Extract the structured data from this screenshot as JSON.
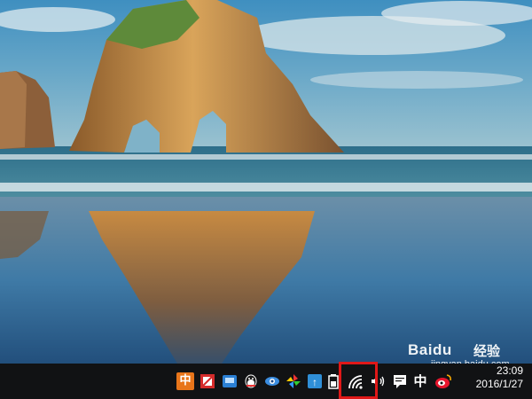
{
  "taskbar": {
    "ime_cn_label": "中",
    "ime_mode_label": "中",
    "tray_icons": [
      "ime-zh-icon",
      "security-icon",
      "network-app-icon",
      "qq-penguin-icon",
      "browser-eye-icon",
      "pinwheel-icon",
      "baidu-app-icon",
      "battery-icon",
      "wifi-icon",
      "volume-icon",
      "action-center-icon",
      "weibo-icon"
    ],
    "clock": {
      "time": "23:09",
      "date": "2016/1/27"
    },
    "highlight_color": "#e01818"
  },
  "watermark": {
    "brand": "Baidu",
    "brand_suffix": "经验",
    "url": "jingyan.baidu.com"
  }
}
